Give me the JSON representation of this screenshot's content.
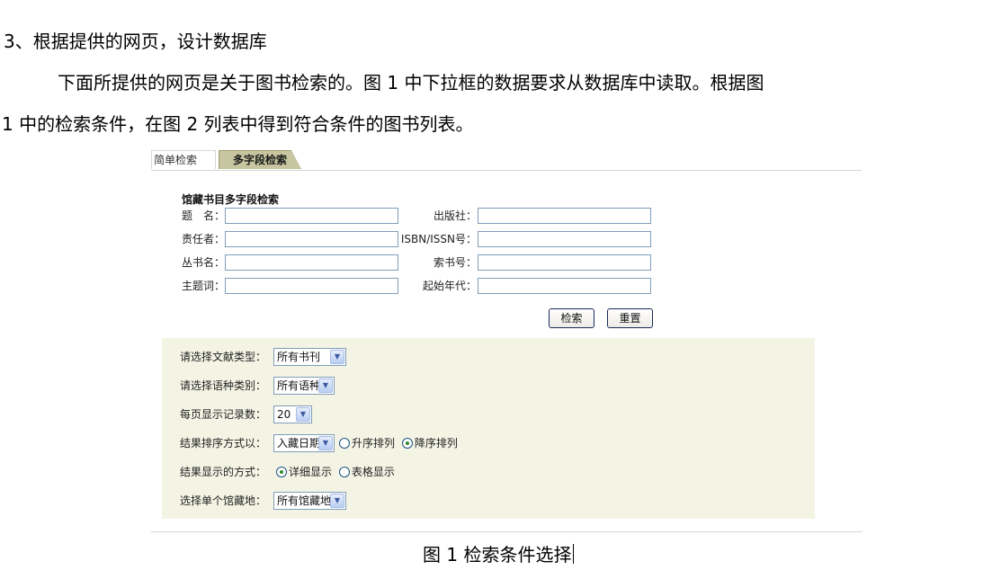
{
  "document": {
    "heading": "3、根据提供的网页，设计数据库",
    "para_line1": "下面所提供的网页是关于图书检索的。图 1 中下拉框的数据要求从数据库中读取。根据图",
    "para_line2": "1 中的检索条件，在图 2 列表中得到符合条件的图书列表。",
    "caption": "图 1 检索条件选择"
  },
  "tabs": [
    {
      "label": "简单检索",
      "active": false
    },
    {
      "label": "多字段检索",
      "active": true
    }
  ],
  "form": {
    "title": "馆藏书目多字段检索",
    "fields": [
      {
        "label": "题　名：",
        "value": ""
      },
      {
        "label": "出版社：",
        "value": ""
      },
      {
        "label": "责任者：",
        "value": ""
      },
      {
        "label": "ISBN/ISSN号：",
        "value": ""
      },
      {
        "label": "丛书名：",
        "value": ""
      },
      {
        "label": "索书号：",
        "value": ""
      },
      {
        "label": "主题词：",
        "value": ""
      },
      {
        "label": "起始年代：",
        "value": ""
      }
    ],
    "search_button": "检索",
    "reset_button": "重置"
  },
  "options": {
    "doc_type": {
      "label": "请选择文献类型：",
      "selected": "所有书刊"
    },
    "language": {
      "label": "请选择语种类别：",
      "selected": "所有语种"
    },
    "page_size": {
      "label": "每页显示记录数：",
      "selected": "20"
    },
    "sort": {
      "label": "结果排序方式以：",
      "selected": "入藏日期",
      "asc": "升序排列",
      "desc": "降序排列",
      "checked": "desc"
    },
    "display": {
      "label": "结果显示的方式：",
      "detail": "详细显示",
      "table": "表格显示",
      "checked": "detail"
    },
    "location": {
      "label": "选择单个馆藏地：",
      "selected": "所有馆藏地"
    }
  },
  "colors": {
    "active_tab": "#c7c6a0",
    "options_bg": "#f4f4e5",
    "input_border": "#7f9db9"
  }
}
